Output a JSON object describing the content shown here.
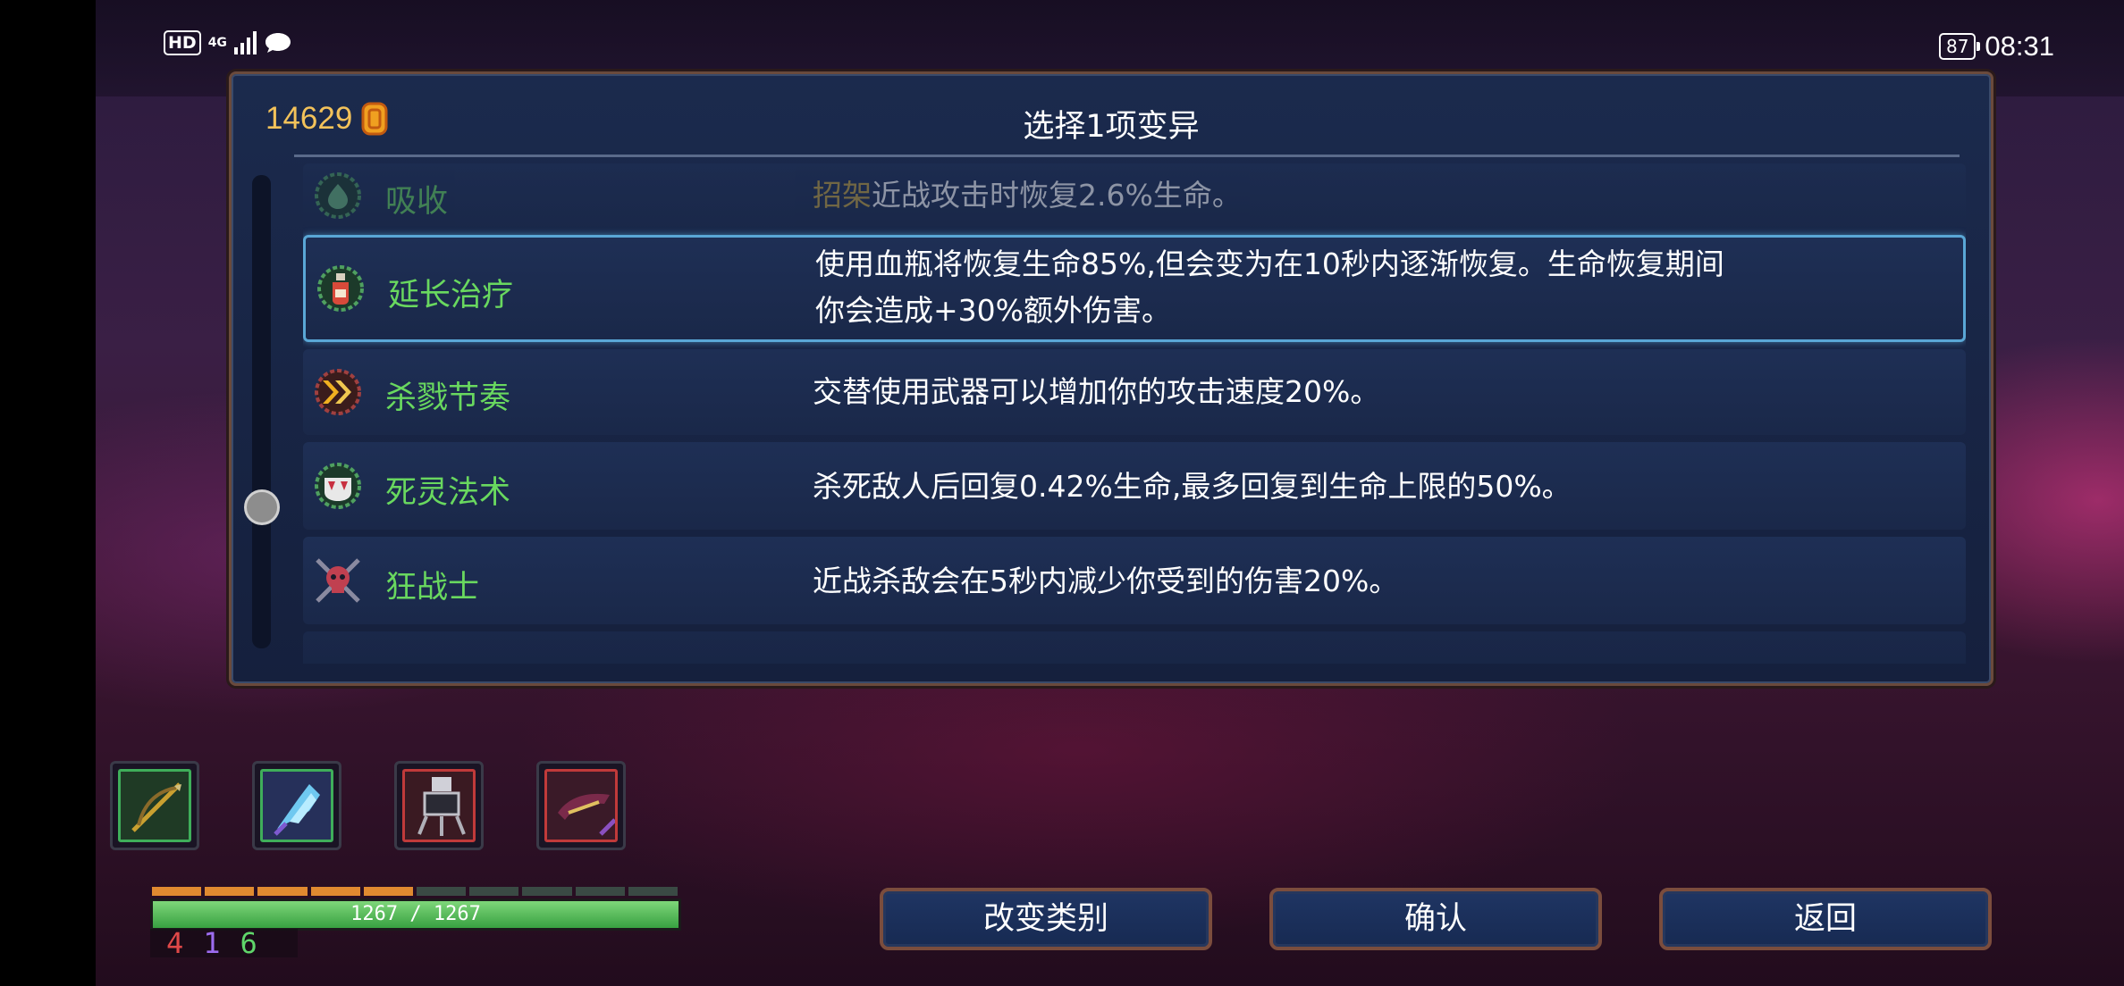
{
  "status_bar": {
    "hd_label": "HD",
    "network": "4G",
    "battery": "87",
    "time": "08:31"
  },
  "panel": {
    "title": "选择1项变异",
    "gold": "14629"
  },
  "mutations": [
    {
      "name": "吸收",
      "keyword": "招架",
      "desc": "近战攻击时恢复2.6%生命。",
      "icon": "heart-drop-icon",
      "state": "faded"
    },
    {
      "name": "延长治疗",
      "desc_line1": "使用血瓶将恢复生命85%,但会变为在10秒内逐渐恢复。生命恢复期间",
      "desc_line2": "你会造成+30%额外伤害。",
      "icon": "potion-icon",
      "state": "selected"
    },
    {
      "name": "杀戮节奏",
      "desc": "交替使用武器可以增加你的攻击速度20%。",
      "icon": "chevrons-icon",
      "state": "normal"
    },
    {
      "name": "死灵法术",
      "desc": "杀死敌人后回复0.42%生命,最多回复到生命上限的50%。",
      "icon": "fangs-icon",
      "state": "normal"
    },
    {
      "name": "狂战士",
      "desc": "近战杀敌会在5秒内减少你受到的伤害20%。",
      "icon": "skull-icon",
      "state": "normal"
    }
  ],
  "scroll_position": 0.5,
  "item_slots": [
    {
      "icon": "bow-icon",
      "border_color": "#3fae5a"
    },
    {
      "icon": "ice-crystal-icon",
      "border_color": "#3fae5a"
    },
    {
      "icon": "turret-icon",
      "border_color": "#c03a3a"
    },
    {
      "icon": "claw-icon",
      "border_color": "#c03a3a"
    }
  ],
  "hp": {
    "text": "1267 / 1267",
    "fraction": 1.0
  },
  "hp_segments": {
    "orange": 5,
    "gray": 5
  },
  "stats": {
    "brutality": "4",
    "tactics": "1",
    "survival": "6"
  },
  "stat_colors": {
    "brutality": "#e04848",
    "tactics": "#9d6cf0",
    "survival": "#5fd66a"
  },
  "buttons": {
    "change_category": "改变类别",
    "confirm": "确认",
    "back": "返回"
  }
}
